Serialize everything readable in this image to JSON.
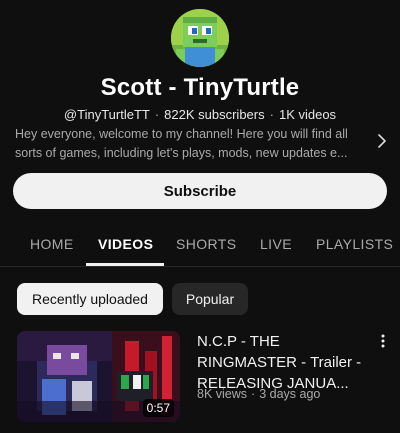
{
  "channel": {
    "name": "Scott - TinyTurtle",
    "handle": "@TinyTurtleTT",
    "subscribers": "822K subscribers",
    "videos": "1K videos",
    "separator": "·",
    "description": "Hey everyone, welcome to my channel! Here you will find all sorts of games, including let's plays,  mods, new updates e..."
  },
  "subscribe": {
    "label": "Subscribe"
  },
  "tabs": [
    {
      "label": "HOME"
    },
    {
      "label": "VIDEOS",
      "active": true
    },
    {
      "label": "SHORTS"
    },
    {
      "label": "LIVE"
    },
    {
      "label": "PLAYLISTS"
    }
  ],
  "filters": [
    {
      "label": "Recently uploaded",
      "selected": true
    },
    {
      "label": "Popular"
    }
  ],
  "videos": [
    {
      "title": "N.C.P - THE RINGMASTER - Trailer - RELEASING JANUA...",
      "views": "8K views",
      "age": "3 days ago",
      "separator": "·",
      "duration": "0:57"
    }
  ],
  "icons": {
    "expand_description": "chevron-right-icon",
    "video_menu": "more-vertical-icon"
  },
  "colors": {
    "background": "#0f0f0f",
    "text_primary": "#f1f1f1",
    "text_secondary": "#aaaaaa",
    "chip_dark": "#272727"
  }
}
